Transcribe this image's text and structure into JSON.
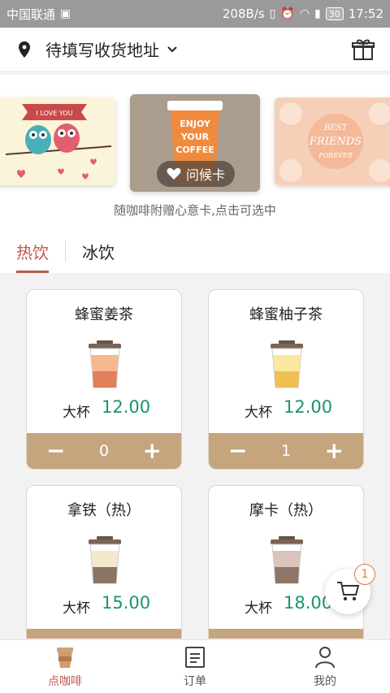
{
  "status_bar": {
    "carrier": "中国联通",
    "speed": "208B/s",
    "battery": "30",
    "time": "17:52"
  },
  "header": {
    "address": "待填写收货地址"
  },
  "cards": {
    "left_card_text": "I LOVE YOU",
    "center_card_text": [
      "ENJOY",
      "YOUR",
      "COFFEE"
    ],
    "right_card_text": [
      "BEST",
      "FRIENDS",
      "FOREVER"
    ],
    "greeting_label": "问候卡",
    "hint": "随咖啡附赠心意卡,点击可选中"
  },
  "tabs": [
    {
      "label": "热饮",
      "active": true
    },
    {
      "label": "冰饮",
      "active": false
    }
  ],
  "products": [
    {
      "name": "蜂蜜姜茶",
      "size": "大杯",
      "price": "12.00",
      "qty": "0",
      "cup_color": "#e0805a",
      "cup_top": "#f6b890"
    },
    {
      "name": "蜂蜜柚子茶",
      "size": "大杯",
      "price": "12.00",
      "qty": "1",
      "cup_color": "#f0c050",
      "cup_top": "#fbe7a0"
    },
    {
      "name": "拿铁（热）",
      "size": "大杯",
      "price": "15.00",
      "qty": "",
      "cup_color": "#8a7562",
      "cup_top": "#f3e7cc"
    },
    {
      "name": "摩卡（热）",
      "size": "大杯",
      "price": "18.00",
      "qty": "",
      "cup_color": "#8f7566",
      "cup_top": "#d9c3bb"
    }
  ],
  "cart": {
    "count": "1"
  },
  "bottom_nav": [
    {
      "label": "点咖啡",
      "active": true
    },
    {
      "label": "订单",
      "active": false
    },
    {
      "label": "我的",
      "active": false
    }
  ],
  "colors": {
    "accent": "#c0584c",
    "price": "#1a9470",
    "qty_bar": "#c4a57e",
    "status_bar": "#9a9a9a"
  }
}
